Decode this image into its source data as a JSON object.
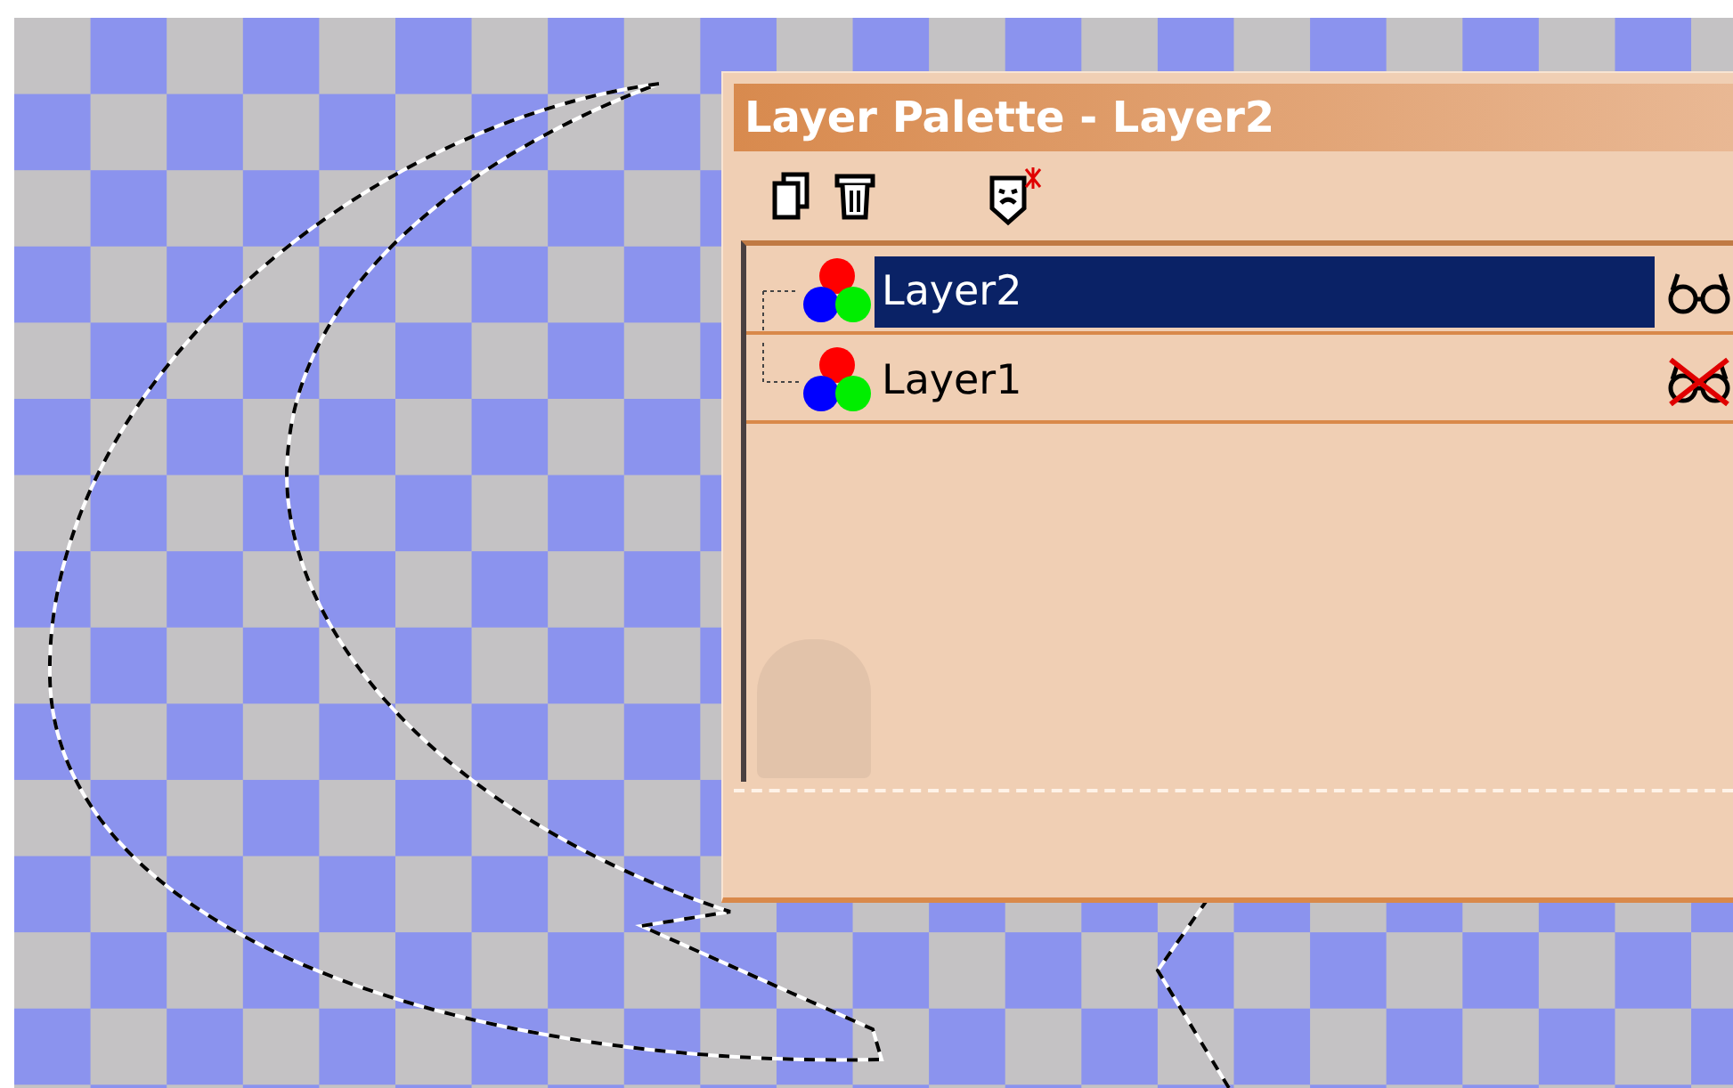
{
  "window": {
    "title": "Layer Palette - Layer2"
  },
  "layers": [
    {
      "name": "Layer2",
      "selected": true,
      "visible": true
    },
    {
      "name": "Layer1",
      "selected": false,
      "visible": false
    }
  ]
}
